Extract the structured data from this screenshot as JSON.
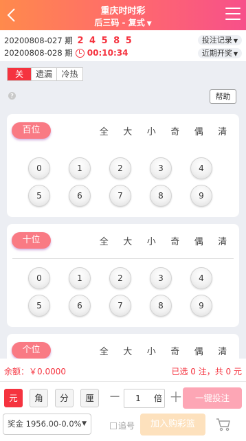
{
  "header": {
    "title": "重庆时时彩",
    "subtitle": "后三码 - 复式",
    "gradient_colors": [
      "#ff8a4c",
      "#ff6b6b",
      "#f7508a"
    ]
  },
  "draw": {
    "last_issue": "20200808-027 期",
    "last_numbers": "2 4 5 8 5",
    "current_issue": "20200808-028 期",
    "countdown": "00:10:34",
    "bet_records": "投注记录",
    "recent_draws": "近期开奖"
  },
  "mode_tabs": [
    {
      "label": "关",
      "active": true
    },
    {
      "label": "遗漏",
      "active": false
    },
    {
      "label": "冷热",
      "active": false
    }
  ],
  "help_label": "帮助",
  "help_icon": "?",
  "quick_picks": [
    "全",
    "大",
    "小",
    "奇",
    "偶",
    "清"
  ],
  "positions": [
    {
      "label": "百位",
      "balls": [
        "0",
        "1",
        "2",
        "3",
        "4",
        "5",
        "6",
        "7",
        "8",
        "9"
      ]
    },
    {
      "label": "十位",
      "balls": [
        "0",
        "1",
        "2",
        "3",
        "4",
        "5",
        "6",
        "7",
        "8",
        "9"
      ]
    },
    {
      "label": "个位",
      "balls": []
    }
  ],
  "bottom": {
    "balance": "余额：￥0.0000",
    "selection_summary": "已选 0 注，共 0 元",
    "units": [
      {
        "label": "元",
        "active": true
      },
      {
        "label": "角",
        "active": false
      },
      {
        "label": "分",
        "active": false
      },
      {
        "label": "厘",
        "active": false
      }
    ],
    "minus": "－",
    "multiplier": "1",
    "multiplier_label": "倍",
    "plus": "＋",
    "one_key_bet": "一键投注",
    "bonus": "奖金 1956.00-0.0%",
    "chase": "追号",
    "add_to_cart": "加入购彩篮"
  },
  "colors": {
    "accent": "#f5333f",
    "position_pill": "#f97a84",
    "bet_button": "#fda6b5",
    "cart_button": "#fde1bd"
  }
}
